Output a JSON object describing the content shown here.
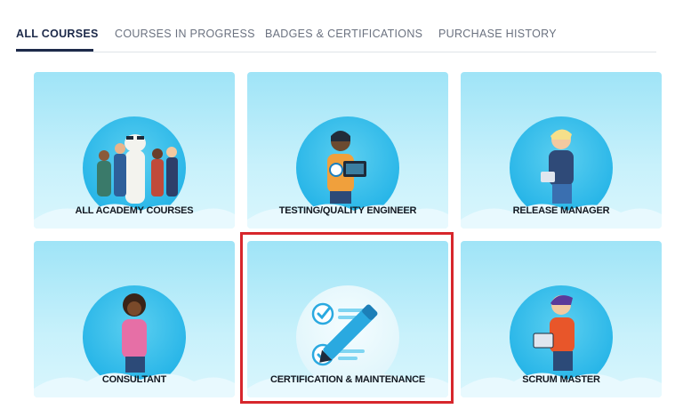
{
  "tabs": [
    {
      "label": "ALL COURSES",
      "active": true
    },
    {
      "label": "COURSES IN PROGRESS",
      "active": false
    },
    {
      "label": "BADGES & CERTIFICATIONS",
      "active": false
    },
    {
      "label": "PURCHASE HISTORY",
      "active": false
    }
  ],
  "cards": [
    {
      "label": "ALL ACADEMY COURSES",
      "icon": "group-with-llama-illustration"
    },
    {
      "label": "TESTING/QUALITY ENGINEER",
      "icon": "engineer-with-laptop-illustration"
    },
    {
      "label": "RELEASE MANAGER",
      "icon": "manager-with-clipboard-illustration"
    },
    {
      "label": "CONSULTANT",
      "icon": "consultant-woman-illustration"
    },
    {
      "label": "CERTIFICATION & MAINTENANCE",
      "icon": "checklist-pen-icon",
      "highlighted": true
    },
    {
      "label": "SCRUM MASTER",
      "icon": "scrum-master-with-calendar-illustration"
    }
  ],
  "colors": {
    "card_bg_top": "#9fe4f7",
    "circle": "#29b6e8",
    "highlight_border": "#d7262c",
    "active_tab": "#1d2a4a"
  }
}
